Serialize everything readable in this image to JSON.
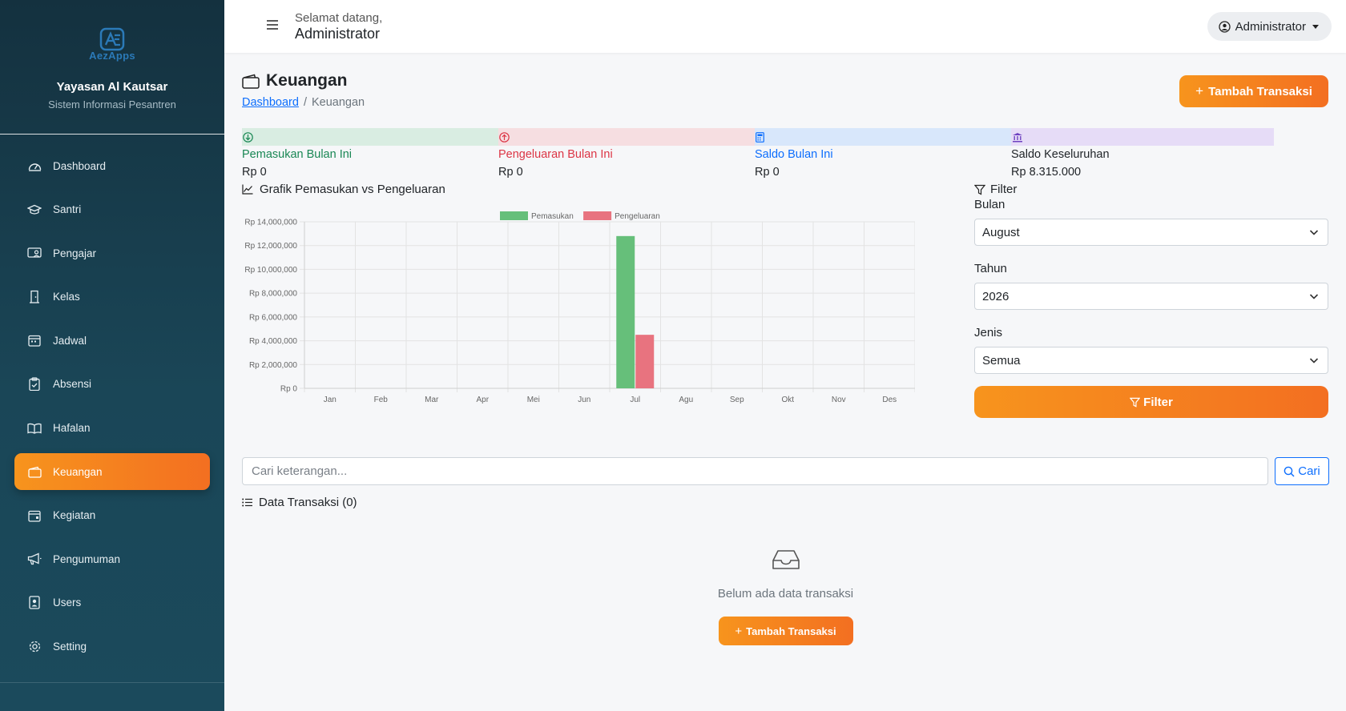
{
  "sidebar": {
    "logo_text": "AezApps",
    "org_name": "Yayasan Al Kautsar",
    "org_subtitle": "Sistem Informasi Pesantren",
    "items": [
      {
        "label": "Dashboard",
        "icon": "speedometer-icon"
      },
      {
        "label": "Santri",
        "icon": "mortarboard-icon"
      },
      {
        "label": "Pengajar",
        "icon": "person-video-icon"
      },
      {
        "label": "Kelas",
        "icon": "door-icon"
      },
      {
        "label": "Jadwal",
        "icon": "calendar-week-icon"
      },
      {
        "label": "Absensi",
        "icon": "clipboard-check-icon"
      },
      {
        "label": "Hafalan",
        "icon": "book-icon"
      },
      {
        "label": "Keuangan",
        "icon": "wallet-icon",
        "active": true
      },
      {
        "label": "Kegiatan",
        "icon": "calendar-event-icon"
      },
      {
        "label": "Pengumuman",
        "icon": "megaphone-icon"
      },
      {
        "label": "Users",
        "icon": "person-badge-icon"
      },
      {
        "label": "Setting",
        "icon": "gear-icon"
      }
    ]
  },
  "topbar": {
    "welcome": "Selamat datang,",
    "user_name": "Administrator",
    "user_menu_label": "Administrator"
  },
  "page": {
    "title": "Keuangan",
    "breadcrumb": {
      "home": "Dashboard",
      "current": "Keuangan",
      "separator": "/"
    },
    "add_button": "Tambah Transaksi"
  },
  "stats": [
    {
      "label": "Pemasukan Bulan Ini",
      "value": "Rp 0",
      "color": "#198754",
      "bg": "#d9ede2",
      "icon": "arrow-down-circle-icon"
    },
    {
      "label": "Pengeluaran Bulan Ini",
      "value": "Rp 0",
      "color": "#dc3545",
      "bg": "#f6dee1",
      "icon": "arrow-up-circle-icon"
    },
    {
      "label": "Saldo Bulan Ini",
      "value": "Rp 0",
      "color": "#0d6efd",
      "bg": "#d8e7fb",
      "icon": "calculator-icon"
    },
    {
      "label": "Saldo Keseluruhan",
      "value": "Rp 8.315.000",
      "color": "#212529",
      "bg": "#e6dcf7",
      "icon": "bank-icon"
    }
  ],
  "chart": {
    "title": "Grafik Pemasukan vs Pengeluaran"
  },
  "chart_data": {
    "type": "bar",
    "categories": [
      "Jan",
      "Feb",
      "Mar",
      "Apr",
      "Mei",
      "Jun",
      "Jul",
      "Agu",
      "Sep",
      "Okt",
      "Nov",
      "Des"
    ],
    "series": [
      {
        "name": "Pemasukan",
        "color": "#66bf7a",
        "values": [
          0,
          0,
          0,
          0,
          0,
          0,
          12800000,
          0,
          0,
          0,
          0,
          0
        ]
      },
      {
        "name": "Pengeluaran",
        "color": "#e8737f",
        "values": [
          0,
          0,
          0,
          0,
          0,
          0,
          4500000,
          0,
          0,
          0,
          0,
          0
        ]
      }
    ],
    "yticks": [
      "Rp 0",
      "Rp 2,000,000",
      "Rp 4,000,000",
      "Rp 6,000,000",
      "Rp 8,000,000",
      "Rp 10,000,000",
      "Rp 12,000,000",
      "Rp 14,000,000"
    ],
    "ylim": [
      0,
      14000000
    ],
    "legend_position": "top",
    "grid": true
  },
  "filter": {
    "title": "Filter",
    "month_label": "Bulan",
    "month_value": "August",
    "year_label": "Tahun",
    "year_value": "2026",
    "type_label": "Jenis",
    "type_value": "Semua",
    "button": "Filter"
  },
  "search": {
    "placeholder": "Cari keterangan...",
    "button": "Cari"
  },
  "transactions": {
    "title": "Data Transaksi (0)",
    "empty_text": "Belum ada data transaksi",
    "empty_button": "Tambah Transaksi"
  },
  "colors": {
    "accent": "#f7941d",
    "accent_dark": "#f36f21",
    "sidebar_bg": "#1a4657"
  }
}
